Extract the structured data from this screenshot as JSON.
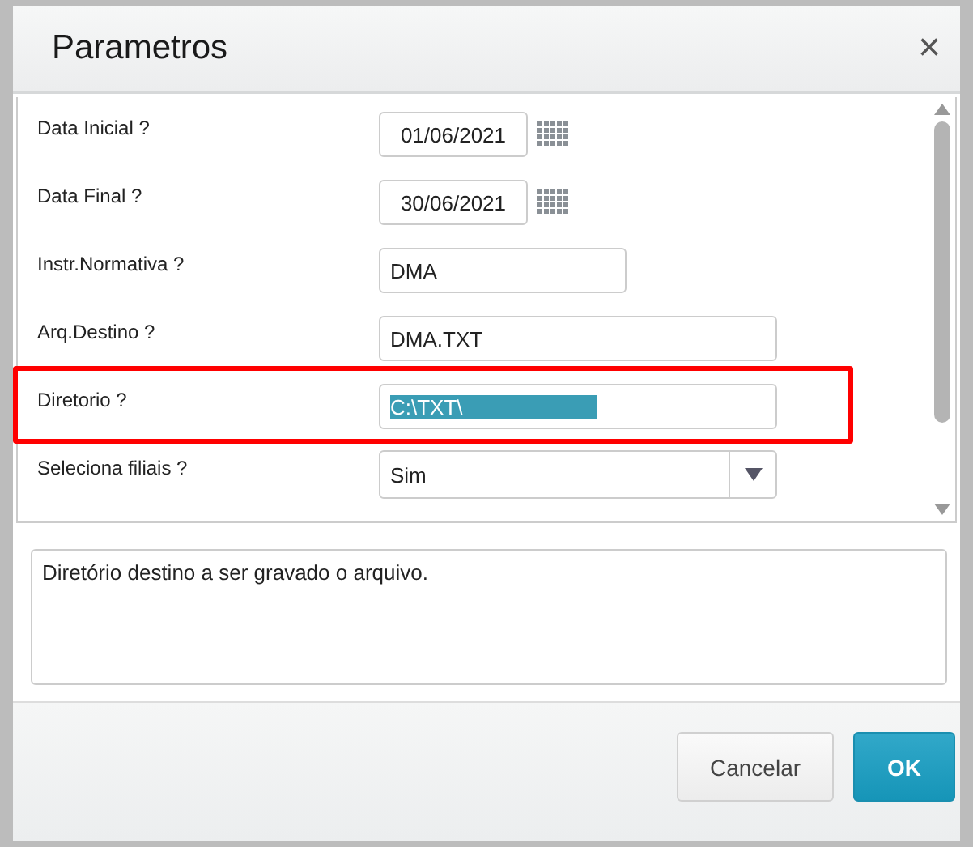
{
  "window": {
    "title": "Parametros",
    "close": "×"
  },
  "parameters": [
    {
      "label": "Data Inicial ?",
      "kind": "date",
      "value": "01/06/2021",
      "highlighted": false,
      "text_selected": false
    },
    {
      "label": "Data Final ?",
      "kind": "date",
      "value": "30/06/2021",
      "highlighted": false,
      "text_selected": false
    },
    {
      "label": "Instr.Normativa ?",
      "kind": "short",
      "value": "DMA",
      "highlighted": false,
      "text_selected": false
    },
    {
      "label": "Arq.Destino ?",
      "kind": "text",
      "value": "DMA.TXT",
      "highlighted": false,
      "text_selected": false
    },
    {
      "label": "Diretorio ?",
      "kind": "text",
      "value": "C:\\TXT\\",
      "highlighted": true,
      "text_selected": true
    },
    {
      "label": "Seleciona filiais ?",
      "kind": "select",
      "value": "Sim",
      "highlighted": false,
      "text_selected": false
    }
  ],
  "description": "Diretório destino a ser gravado o arquivo.",
  "buttons": [
    {
      "label": "Cancelar",
      "kind": "secondary"
    },
    {
      "label": "OK",
      "kind": "primary"
    }
  ]
}
